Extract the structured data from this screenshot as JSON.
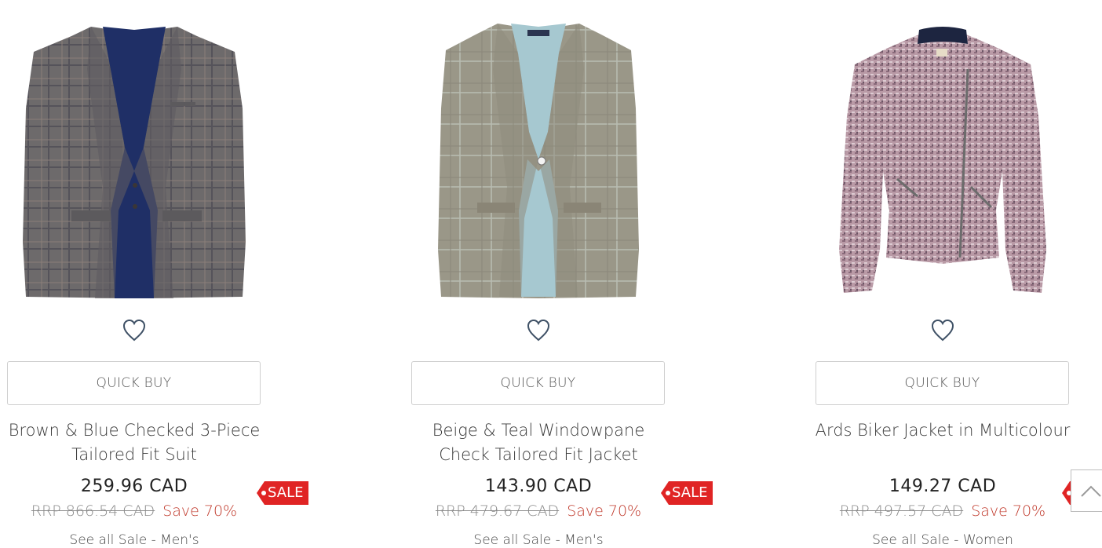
{
  "products": [
    {
      "name_line1": "Brown & Blue Checked 3-Piece",
      "name_line2": "Tailored Fit Suit",
      "price": "259.96 CAD",
      "rrp": "RRP 866.54 CAD",
      "save": "Save 70%",
      "quick_buy": "QUICK BUY",
      "see_all": "See all Sale - Men's",
      "badge": "SALE"
    },
    {
      "name_line1": "Beige & Teal Windowpane",
      "name_line2": "Check Tailored Fit Jacket",
      "price": "143.90 CAD",
      "rrp": "RRP 479.67 CAD",
      "save": "Save 70%",
      "quick_buy": "QUICK BUY",
      "see_all": "See all Sale - Men's",
      "badge": "SALE"
    },
    {
      "name_line1": "Ards Biker Jacket in Multicolour",
      "name_line2": "",
      "price": "149.27 CAD",
      "rrp": "RRP 497.57 CAD",
      "save": "Save 70%",
      "quick_buy": "QUICK BUY",
      "see_all": "See all Sale - Women",
      "badge": ""
    }
  ],
  "icons": {
    "wishlist": "heart-icon",
    "back_to_top": "chevron-up-icon"
  },
  "colors": {
    "sale_badge": "#e02424",
    "save_text": "#c0392b",
    "rrp_text": "#8a8a8a"
  }
}
